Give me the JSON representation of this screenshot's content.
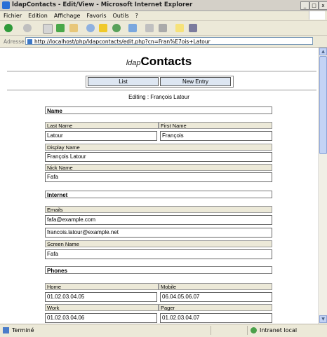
{
  "window": {
    "title": "ldapContacts - Edit/View - Microsoft Internet Explorer"
  },
  "menu": [
    "Fichier",
    "Edition",
    "Affichage",
    "Favoris",
    "Outils",
    "?"
  ],
  "address": {
    "label": "Adresse",
    "url": "http://localhost/php/ldapcontacts/edit.php?cn=Fran%E7ois+Latour"
  },
  "page": {
    "title_prefix": "ldap",
    "title_main": "Contacts",
    "nav": {
      "list": "List",
      "new_entry": "New Entry"
    },
    "editing": "Editing : François Latour",
    "sections": {
      "name": "Name",
      "internet": "Internet",
      "phones": "Phones"
    },
    "fields": {
      "last_name": {
        "label": "Last Name",
        "value": "Latour"
      },
      "first_name": {
        "label": "First Name",
        "value": "François"
      },
      "display_name": {
        "label": "Display Name",
        "value": "François Latour"
      },
      "nick_name": {
        "label": "Nick Name",
        "value": "Fafa"
      },
      "emails": {
        "label": "Emails",
        "values": [
          "fafa@example.com",
          "francois.latour@example.net"
        ]
      },
      "screen_name": {
        "label": "Screen Name",
        "value": "Fafa"
      },
      "home": {
        "label": "Home",
        "value": "01.02.03.04.05"
      },
      "mobile": {
        "label": "Mobile",
        "value": "06.04.05.06.07"
      },
      "work": {
        "label": "Work",
        "value": "01.02.03.04.06"
      },
      "pager": {
        "label": "Pager",
        "value": "01.02.03.04.07"
      }
    }
  },
  "status": {
    "text": "Terminé",
    "zone": "Intranet local"
  }
}
